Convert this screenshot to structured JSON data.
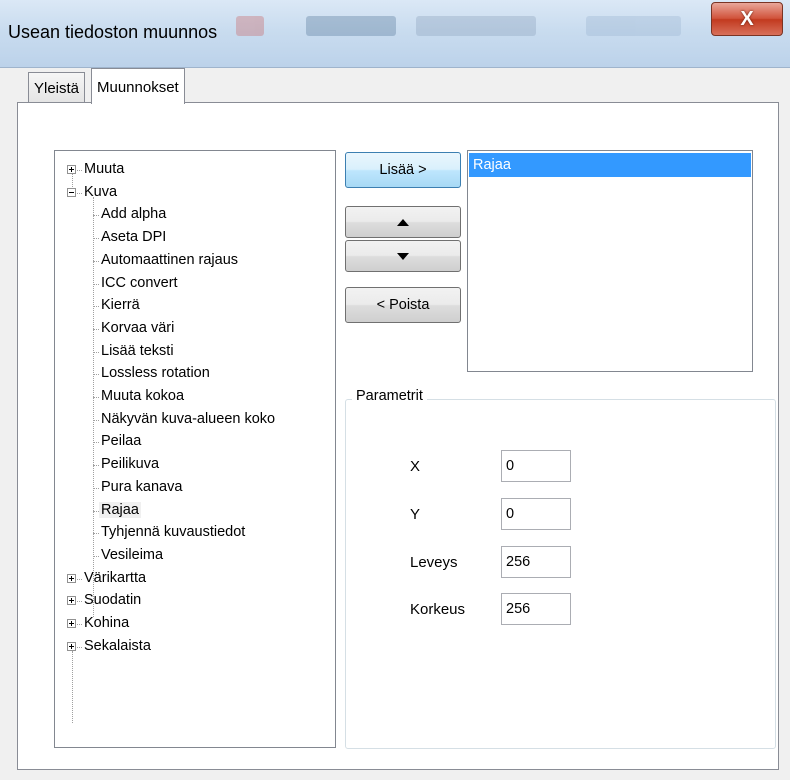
{
  "window": {
    "title": "Usean tiedoston muunnos",
    "close_label": "X"
  },
  "tabs": [
    {
      "label": "Yleistä"
    },
    {
      "label": "Muunnokset"
    }
  ],
  "tree": {
    "items": [
      {
        "label": "Muuta",
        "level": 0,
        "expander": "plus"
      },
      {
        "label": "Kuva",
        "level": 0,
        "expander": "minus"
      },
      {
        "label": "Add alpha",
        "level": 1
      },
      {
        "label": "Aseta DPI",
        "level": 1
      },
      {
        "label": "Automaattinen rajaus",
        "level": 1
      },
      {
        "label": "ICC convert",
        "level": 1
      },
      {
        "label": "Kierrä",
        "level": 1
      },
      {
        "label": "Korvaa väri",
        "level": 1
      },
      {
        "label": "Lisää teksti",
        "level": 1
      },
      {
        "label": "Lossless rotation",
        "level": 1
      },
      {
        "label": "Muuta kokoa",
        "level": 1
      },
      {
        "label": "Näkyvän kuva-alueen koko",
        "level": 1
      },
      {
        "label": "Peilaa",
        "level": 1
      },
      {
        "label": "Peilikuva",
        "level": 1
      },
      {
        "label": "Pura kanava",
        "level": 1
      },
      {
        "label": "Rajaa",
        "level": 1,
        "selected": true
      },
      {
        "label": "Tyhjennä kuvaustiedot",
        "level": 1
      },
      {
        "label": "Vesileima",
        "level": 1
      },
      {
        "label": "Värikartta",
        "level": 0,
        "expander": "plus"
      },
      {
        "label": "Suodatin",
        "level": 0,
        "expander": "plus"
      },
      {
        "label": "Kohina",
        "level": 0,
        "expander": "plus"
      },
      {
        "label": "Sekalaista",
        "level": 0,
        "expander": "plus"
      }
    ]
  },
  "buttons": {
    "add_label": "Lisää >",
    "remove_label": "< Poista",
    "up_icon": "up-arrow-icon",
    "down_icon": "down-arrow-icon"
  },
  "selected_list": {
    "items": [
      "Rajaa"
    ]
  },
  "parameters": {
    "title": "Parametrit",
    "fields": [
      {
        "label": "X",
        "value": "0"
      },
      {
        "label": "Y",
        "value": "0"
      },
      {
        "label": "Leveys",
        "value": "256"
      },
      {
        "label": "Korkeus",
        "value": "256"
      }
    ]
  },
  "colors": {
    "selection": "#3399ff",
    "close_button": "#c23a1f",
    "titlebar": "#c9dcef"
  }
}
